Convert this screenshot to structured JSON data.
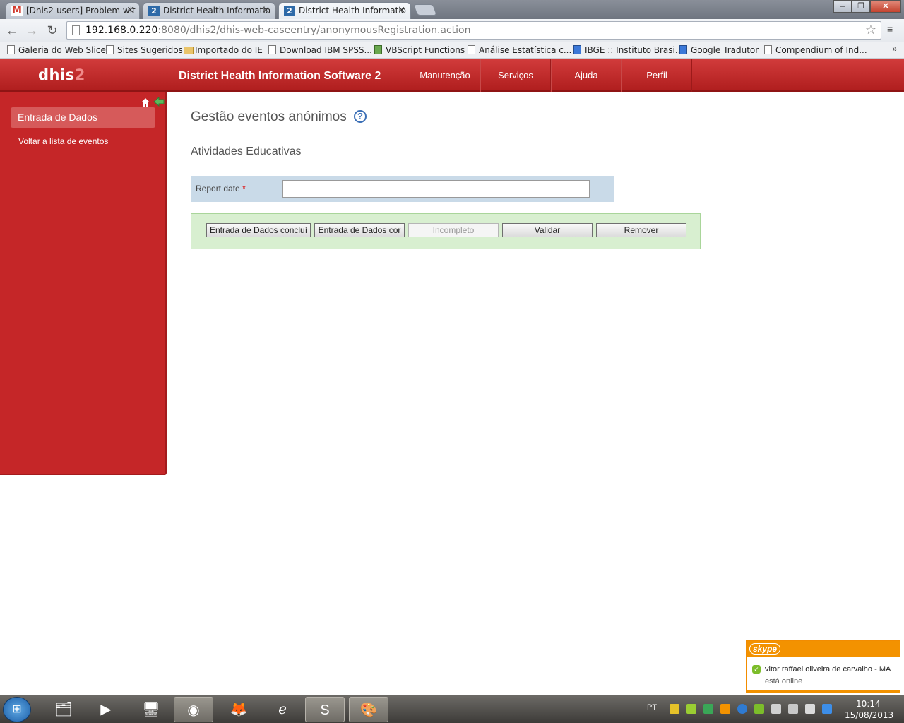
{
  "browser": {
    "tabs": [
      {
        "label": "[Dhis2-users] Problem wit",
        "icon": "gmail-icon",
        "icon_text": "M"
      },
      {
        "label": "District Health Informatio",
        "icon": "dhis2-favicon",
        "icon_text": "2"
      },
      {
        "label": "District Health Informatio",
        "icon": "dhis2-favicon",
        "icon_text": "2"
      }
    ],
    "close_glyph": "×",
    "url_host": "192.168.0.220",
    "url_rest": ":8080/dhis2/dhis-web-caseentry/anonymousRegistration.action",
    "bookmarks": [
      "Galeria do Web Slice",
      "Sites Sugeridos",
      "Importado do IE",
      "Download IBM SPSS...",
      "VBScript Functions",
      "Análise Estatística c...",
      "IBGE :: Instituto Brasi...",
      "Google Tradutor",
      "Compendium of Ind..."
    ],
    "bookmarks_more": "»"
  },
  "header": {
    "logo_main": "dhis",
    "logo_two": "2",
    "title": "District Health Information Software 2",
    "menu": [
      "Manutenção",
      "Serviços",
      "Ajuda",
      "Perfil"
    ]
  },
  "sidebar": {
    "active_item": "Entrada de Dados",
    "link": "Voltar a lista de eventos"
  },
  "main": {
    "page_title": "Gestão eventos anónimos",
    "help_glyph": "?",
    "program_stage": "Atividades Educativas",
    "report_date_label": "Report date",
    "required_mark": "*",
    "report_date_value": "",
    "buttons": [
      {
        "label": "Entrada de Dados concluí",
        "disabled": false
      },
      {
        "label": "Entrada de Dados cor",
        "disabled": false
      },
      {
        "label": "Incompleto",
        "disabled": true
      },
      {
        "label": "Validar",
        "disabled": false
      },
      {
        "label": "Remover",
        "disabled": false
      }
    ]
  },
  "skype": {
    "logo": "skype",
    "contact": "vitor raffael oliveira de carvalho - MA",
    "status": "está online"
  },
  "taskbar": {
    "language": "PT",
    "time": "10:14",
    "date": "15/08/2013"
  },
  "colors": {
    "header_red": "#c52628",
    "button_bar_green": "#d8efd0",
    "date_row_blue": "#c9dae8",
    "skype_orange": "#f39200"
  }
}
